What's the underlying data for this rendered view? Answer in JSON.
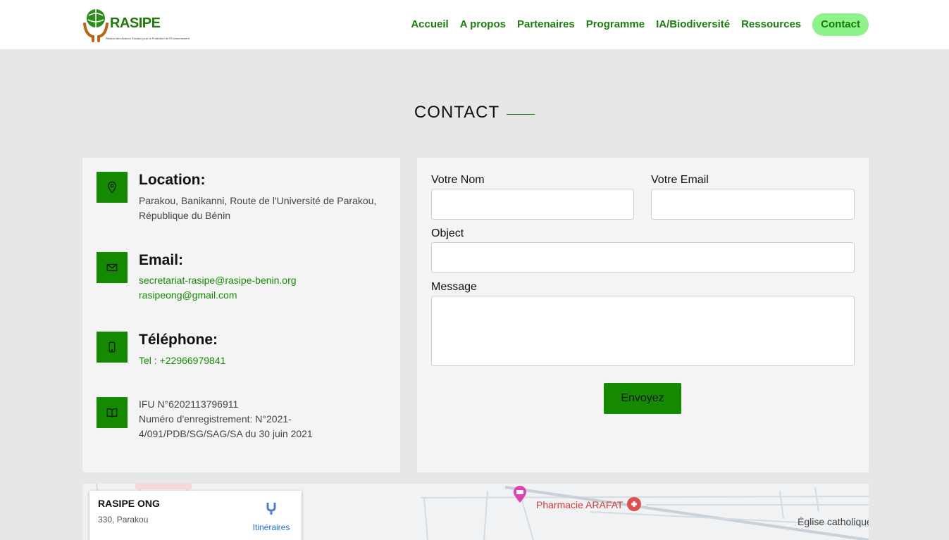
{
  "header": {
    "logo_text": "RASIPE",
    "logo_subtitle": "Réseau des Acteurs Sociaux pour la Protection de l'Environnement",
    "nav": [
      {
        "label": "Accueil"
      },
      {
        "label": "A propos"
      },
      {
        "label": "Partenaires"
      },
      {
        "label": "Programme"
      },
      {
        "label": "IA/Biodiversité"
      },
      {
        "label": "Ressources"
      },
      {
        "label": "Contact",
        "active": true
      }
    ]
  },
  "section": {
    "title": "CONTACT"
  },
  "info": {
    "location": {
      "heading": "Location:",
      "line1": "Parakou, Banikanni, Route de l'Université de Parakou,",
      "line2": "République du Bénin"
    },
    "email": {
      "heading": "Email:",
      "line1": "secretariat-rasipe@rasipe-benin.org",
      "line2": "rasipeong@gmail.com"
    },
    "phone": {
      "heading": "Téléphone:",
      "line1": "Tel : +22966979841"
    },
    "registration": {
      "line1": "IFU N°6202113796911",
      "line2": "Numéro d'enregistrement: N°2021-",
      "line3": "4/091/PDB/SG/SAG/SA du 30 juin 2021"
    }
  },
  "form": {
    "name_label": "Votre Nom",
    "email_label": "Votre Email",
    "object_label": "Object",
    "message_label": "Message",
    "name_value": "",
    "email_value": "",
    "object_value": "",
    "message_value": "",
    "submit_label": "Envoyez"
  },
  "map": {
    "place_name": "RASIPE ONG",
    "place_address": "330, Parakou",
    "directions_label": "Itinéraires",
    "poi_pharmacy": "Pharmacie ARAFAT",
    "poi_church": "Église catholique"
  },
  "colors": {
    "brand_green": "#138a00",
    "nav_green": "#1a7f0e",
    "active_bg": "#8ef38a",
    "page_bg": "#e7e7e7",
    "card_bg": "#f4f4f4"
  }
}
